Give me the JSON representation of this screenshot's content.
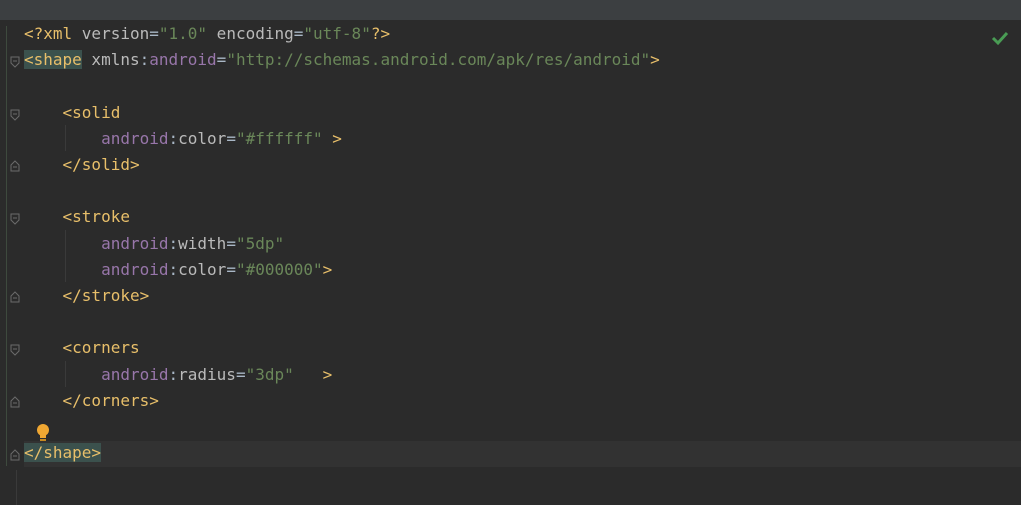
{
  "editor": {
    "lines": [
      {
        "parts": [
          [
            "tag",
            "<?"
          ],
          [
            "tag",
            "xml "
          ],
          [
            "attr",
            "version"
          ],
          [
            "plain",
            "="
          ],
          [
            "val",
            "\"1.0\""
          ],
          [
            "attr",
            " encoding"
          ],
          [
            "plain",
            "="
          ],
          [
            "val",
            "\"utf-8\""
          ],
          [
            "tag",
            "?>"
          ]
        ]
      },
      {
        "parts": [
          [
            "tag hl",
            "<shape"
          ],
          [
            "attr",
            " xmlns"
          ],
          [
            "plain",
            ":"
          ],
          [
            "ns",
            "android"
          ],
          [
            "plain",
            "="
          ],
          [
            "val",
            "\"http://schemas.android.com/apk/res/android\""
          ],
          [
            "tag",
            ">"
          ]
        ]
      },
      {
        "parts": []
      },
      {
        "parts": [
          [
            "plain",
            "    "
          ],
          [
            "tag",
            "<solid"
          ]
        ]
      },
      {
        "parts": [
          [
            "plain",
            "        "
          ],
          [
            "ns",
            "android"
          ],
          [
            "plain",
            ":"
          ],
          [
            "attr",
            "color"
          ],
          [
            "plain",
            "="
          ],
          [
            "val",
            "\"#ffffff\""
          ],
          [
            "tag",
            " >"
          ]
        ]
      },
      {
        "parts": [
          [
            "plain",
            "    "
          ],
          [
            "tag",
            "</solid>"
          ]
        ]
      },
      {
        "parts": []
      },
      {
        "parts": [
          [
            "plain",
            "    "
          ],
          [
            "tag",
            "<stroke"
          ]
        ]
      },
      {
        "parts": [
          [
            "plain",
            "        "
          ],
          [
            "ns",
            "android"
          ],
          [
            "plain",
            ":"
          ],
          [
            "attr",
            "width"
          ],
          [
            "plain",
            "="
          ],
          [
            "val",
            "\"5dp\""
          ]
        ]
      },
      {
        "parts": [
          [
            "plain",
            "        "
          ],
          [
            "ns",
            "android"
          ],
          [
            "plain",
            ":"
          ],
          [
            "attr",
            "color"
          ],
          [
            "plain",
            "="
          ],
          [
            "val",
            "\"#000000\""
          ],
          [
            "tag",
            ">"
          ]
        ]
      },
      {
        "parts": [
          [
            "plain",
            "    "
          ],
          [
            "tag",
            "</stroke>"
          ]
        ]
      },
      {
        "parts": []
      },
      {
        "parts": [
          [
            "plain",
            "    "
          ],
          [
            "tag",
            "<corners"
          ]
        ]
      },
      {
        "parts": [
          [
            "plain",
            "        "
          ],
          [
            "ns",
            "android"
          ],
          [
            "plain",
            ":"
          ],
          [
            "attr",
            "radius"
          ],
          [
            "plain",
            "="
          ],
          [
            "val",
            "\"3dp\""
          ],
          [
            "tag",
            "   >"
          ]
        ]
      },
      {
        "parts": [
          [
            "plain",
            "    "
          ],
          [
            "tag",
            "</corners>"
          ]
        ]
      },
      {
        "parts": []
      },
      {
        "parts": [
          [
            "tag hl",
            "</shape>"
          ]
        ]
      }
    ]
  },
  "status": {
    "icon": "checkmark-icon",
    "color": "#499c54"
  },
  "intention": {
    "icon": "lightbulb-icon",
    "color": "#f0a732"
  },
  "colors": {
    "tag": "#e8bf6a",
    "attribute": "#bababa",
    "namespace": "#9876aa",
    "value": "#6a8759",
    "background": "#2b2b2b"
  }
}
